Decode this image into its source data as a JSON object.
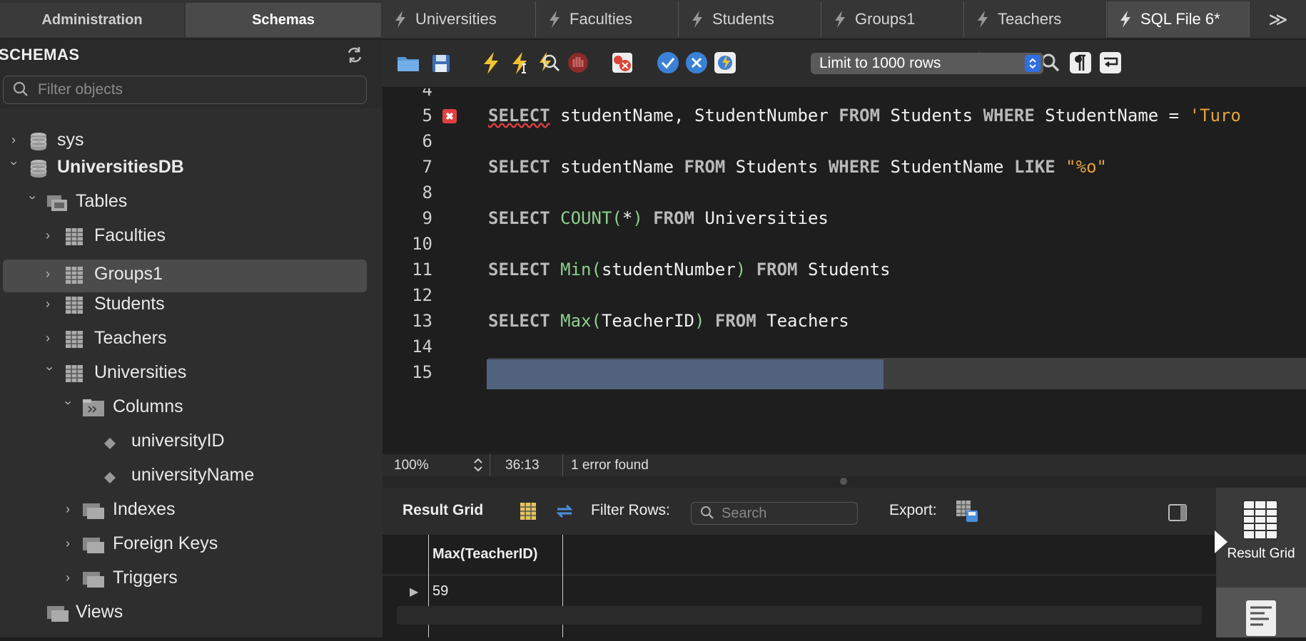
{
  "left_tabs": {
    "administration": "Administration",
    "schemas": "Schemas"
  },
  "schemas_panel": {
    "title": "SCHEMAS",
    "filter_placeholder": "Filter objects"
  },
  "tree": {
    "sys": "sys",
    "db": "UniversitiesDB",
    "tables": "Tables",
    "faculties": "Faculties",
    "groups1": "Groups1",
    "students": "Students",
    "teachers": "Teachers",
    "universities": "Universities",
    "columns": "Columns",
    "col1": "universityID",
    "col2": "universityName",
    "indexes": "Indexes",
    "foreign_keys": "Foreign Keys",
    "triggers": "Triggers",
    "views": "Views"
  },
  "doc_tabs": [
    "Universities",
    "Faculties",
    "Students",
    "Groups1",
    "Teachers",
    "SQL File 6*"
  ],
  "doc_tabs_overflow": "≫",
  "toolbar": {
    "limit_label": "Limit to 1000 rows"
  },
  "editor": {
    "lines": {
      "l4": "4",
      "l5": "5",
      "l6": "6",
      "l7": "7",
      "l8": "8",
      "l9": "9",
      "l10": "10",
      "l11": "11",
      "l12": "12",
      "l13": "13",
      "l14": "14",
      "l15": "15"
    },
    "line5": {
      "kw1": "SELECT",
      "t1": " studentName, StudentNumber ",
      "kw2": "FROM",
      "t2": " Students ",
      "kw3": "WHERE",
      "t3": " StudentName = ",
      "str": "'Turo"
    },
    "line7": {
      "kw1": "SELECT",
      "t1": " studentName ",
      "kw2": "FROM",
      "t2": " Students ",
      "kw3": "WHERE",
      "t3": " StudentName ",
      "kw4": "LIKE",
      "str": " \"%o\""
    },
    "line9": {
      "kw1": "SELECT",
      "fn": " COUNT(",
      "t1": "*",
      "fn2": ")",
      "kw2": " FROM",
      "t2": " Universities"
    },
    "line11": {
      "kw1": "SELECT",
      "fn": " Min(",
      "t1": "studentNumber",
      "fn2": ")",
      "kw2": " FROM",
      "t2": " Students"
    },
    "line13": {
      "kw1": "SELECT",
      "fn": " Max(",
      "t1": "TeacherID",
      "fn2": ")",
      "kw2": " FROM",
      "t2": " Teachers"
    }
  },
  "statusbar": {
    "zoom": "100%",
    "cursor": "36:13",
    "errors": "1 error found"
  },
  "result_toolbar": {
    "result_grid": "Result Grid",
    "filter_rows": "Filter Rows:",
    "search_placeholder": "Search",
    "export": "Export:"
  },
  "grid": {
    "column": "Max(TeacherID)",
    "value": "59"
  },
  "side_panel": {
    "result_grid": "Result Grid"
  },
  "colors": {
    "selection": "#51627f",
    "keyword": "#b9b9b9",
    "function": "#8fcf8f",
    "string": "#e8a23a",
    "error": "#e04040"
  }
}
